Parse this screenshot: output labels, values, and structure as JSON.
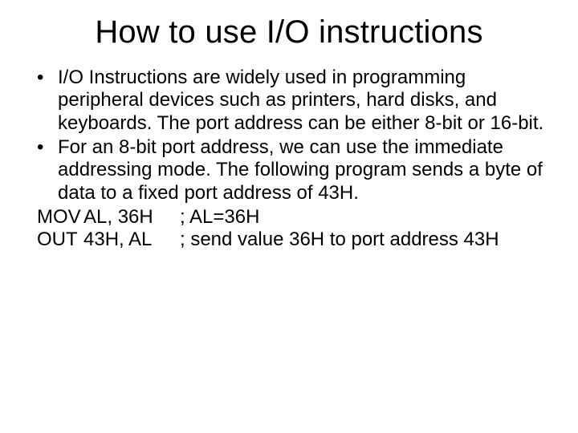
{
  "title": "How to use I/O instructions",
  "bullets": [
    "I/O Instructions are widely used in programming peripheral devices such as printers, hard disks, and keyboards. The port address can be either 8-bit or 16-bit.",
    "For an 8-bit port address, we can use the immediate addressing mode. The following program sends a byte of data to a fixed port address of 43H."
  ],
  "code": [
    {
      "mnemonic": "MOV",
      "args": "AL, 36H",
      "comment": "; AL=36H"
    },
    {
      "mnemonic": "OUT",
      "args": "43H, AL",
      "comment": "; send value 36H to port address 43H"
    }
  ]
}
